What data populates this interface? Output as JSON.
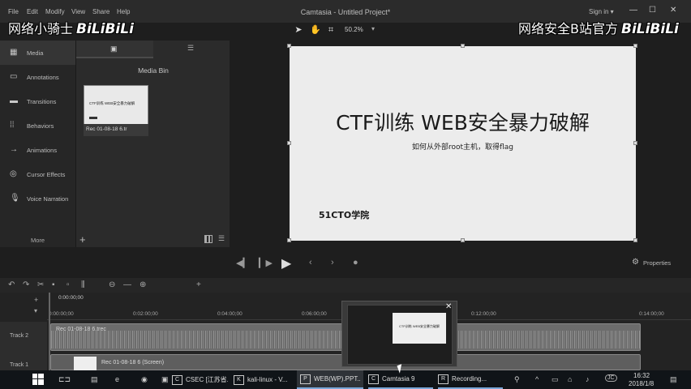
{
  "menubar": {
    "items": [
      "File",
      "Edit",
      "Modify",
      "View",
      "Share",
      "Help"
    ],
    "title": "Camtasia - Untitled Project*",
    "signin": "Sign in ▾"
  },
  "watermarks": {
    "left_text": "网络小骑士",
    "left_logo": "BiLiBiLi",
    "right_text": "网络安全B站官方",
    "right_logo": "BiLiBiLi"
  },
  "toolbar": {
    "zoom": "50.2%"
  },
  "nav": {
    "items": [
      {
        "label": "Media",
        "icon": "film-icon"
      },
      {
        "label": "Annotations",
        "icon": "speech-bubble-icon"
      },
      {
        "label": "Transitions",
        "icon": "transition-icon"
      },
      {
        "label": "Behaviors",
        "icon": "behavior-icon"
      },
      {
        "label": "Animations",
        "icon": "arrow-icon"
      },
      {
        "label": "Cursor Effects",
        "icon": "cursor-icon"
      },
      {
        "label": "Voice Narration",
        "icon": "microphone-icon"
      }
    ],
    "more": "More"
  },
  "media_bin": {
    "title": "Media Bin",
    "clip": {
      "caption": "Rec 01-08-18 6.tr",
      "thumb_text": "CTF训练 WEB安全暴力破解"
    }
  },
  "slide": {
    "title": "CTF训练 WEB安全暴力破解",
    "subtitle": "如何从外部root主机，取得flag",
    "logo": "51CTO学院"
  },
  "playback": {
    "properties": "Properties"
  },
  "timeline": {
    "playhead_time": "0:00:00;00",
    "ruler": [
      "0:00:00;00",
      "0:02:00;00",
      "0:04:00;00",
      "0:06:00;00",
      "0:12:00;00",
      "0:14:00;00"
    ],
    "tracks": [
      {
        "label": "Track 2",
        "clip": "Rec 01-08-18 6.trec"
      },
      {
        "label": "Track 1",
        "clip": "Rec 01-08-18 6 (Screen)"
      }
    ]
  },
  "taskbar": {
    "apps": [
      {
        "label": "CSEC [江苏省...",
        "icon": "C"
      },
      {
        "label": "kali-linux - V...",
        "icon": "K"
      },
      {
        "label": "WEB(WP).PPT...",
        "icon": "P"
      },
      {
        "label": "Camtasia 9",
        "icon": "C"
      },
      {
        "label": "Recording...",
        "icon": "R"
      }
    ],
    "time": "16:32",
    "date": "2018/1/8",
    "tray_badge": "JC"
  },
  "colors": {
    "accent": "#7aa7d8",
    "panel": "#2b2b2b",
    "background": "#1e1e1e"
  }
}
